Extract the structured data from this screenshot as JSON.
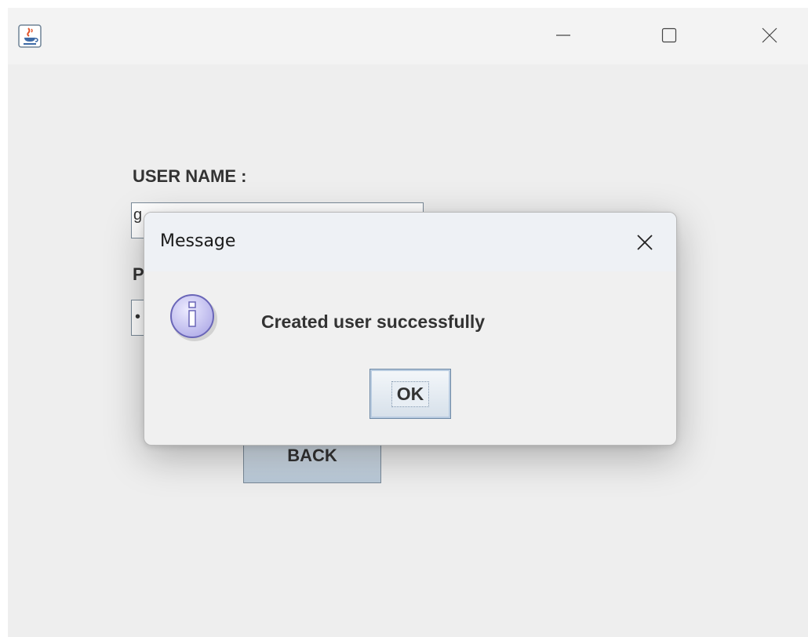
{
  "window": {
    "icon": "java-cup-icon",
    "controls": [
      "minimize-icon",
      "maximize-icon",
      "close-icon"
    ]
  },
  "form": {
    "username_label": "USER NAME :",
    "username_value": "g",
    "password_label": "P",
    "password_value": "•",
    "back_label": "BACK"
  },
  "dialog": {
    "title": "Message",
    "icon": "info-icon",
    "message": "Created user successfully",
    "ok_label": "OK"
  },
  "colors": {
    "window_bg": "#eeeeee",
    "dialog_bg": "#f0f0f0",
    "info_icon_fill": "#c9c6ee",
    "info_icon_stroke": "#6a66b8"
  }
}
